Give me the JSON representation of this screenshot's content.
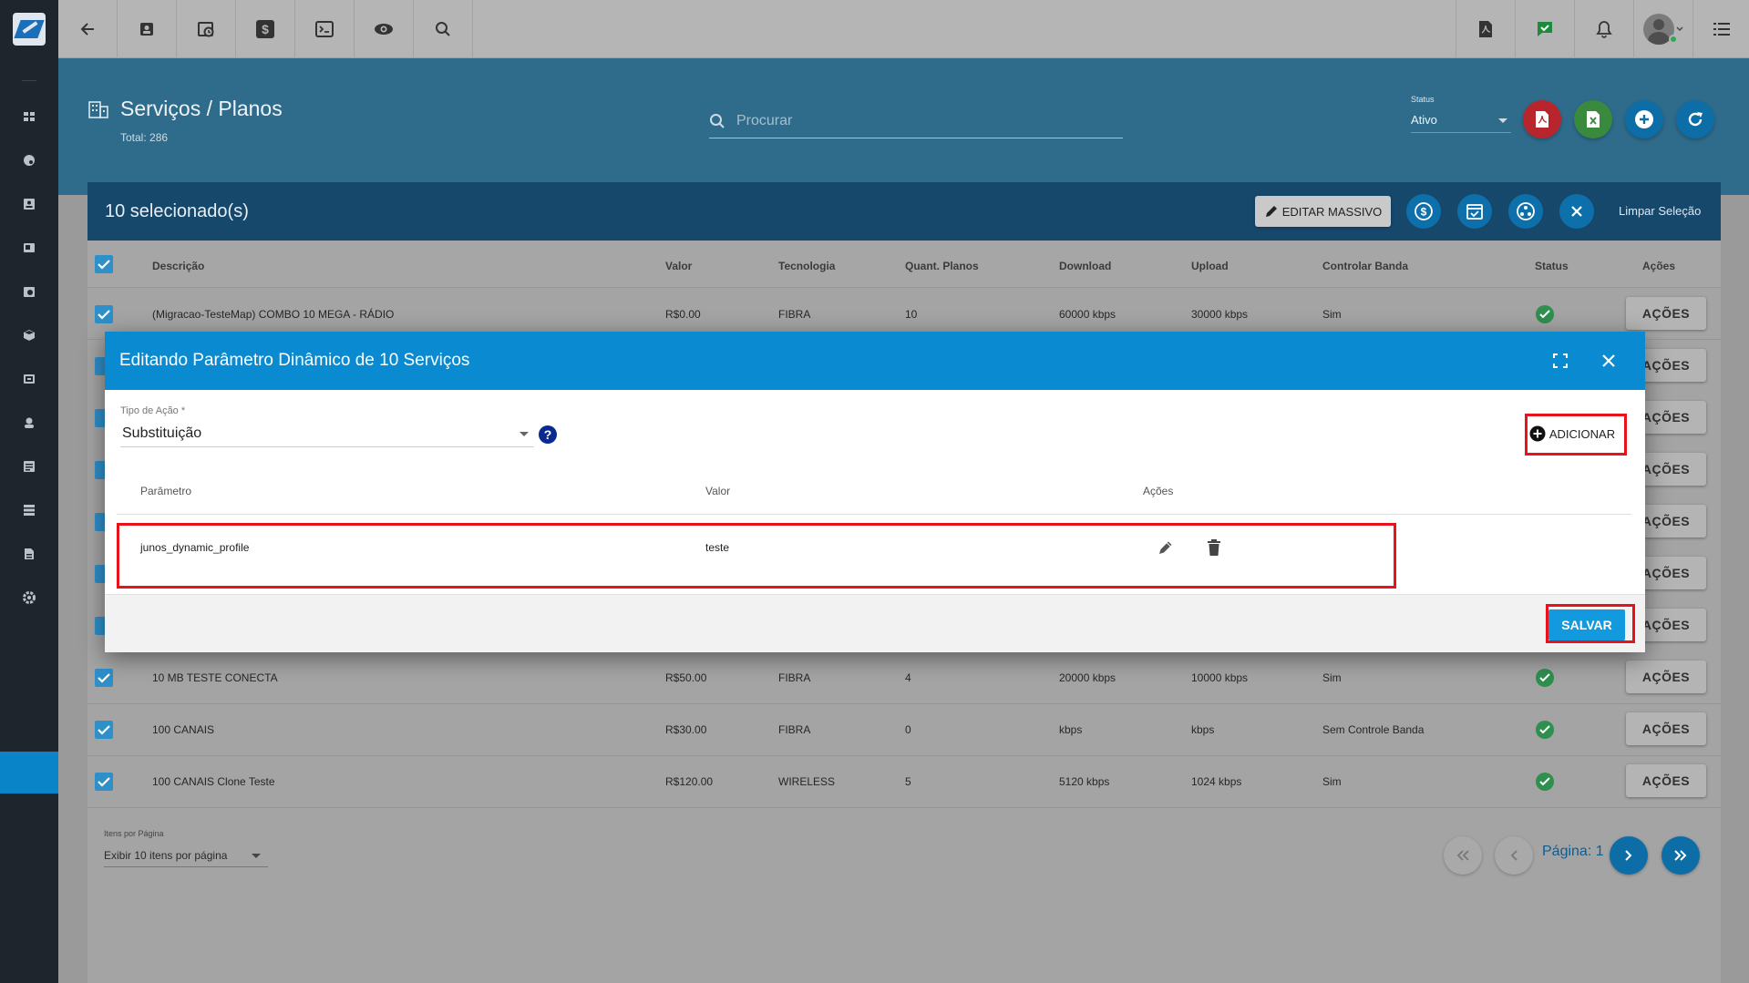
{
  "colors": {
    "sidebar": "#1f252d",
    "banner": "#2f6c8c",
    "selection_bar": "#16486c",
    "modal_header": "#0a8ad0",
    "highlight": "#e8121d",
    "save": "#1399dd"
  },
  "topbar": {
    "left_icons": [
      "back-arrow-icon",
      "contact-card-icon",
      "calendar-clock-icon",
      "dollar-icon",
      "terminal-icon",
      "eye-icon",
      "search-icon"
    ],
    "right_icons": [
      "pdf-document-icon",
      "chat-check-icon",
      "bell-icon",
      "avatar",
      "menu-list-icon"
    ]
  },
  "sidebar": {
    "icons": [
      "dashboard-icon",
      "palette-icon",
      "contacts-icon",
      "document-icon",
      "calendar-icon",
      "box-icon",
      "billing-icon",
      "headset-icon",
      "list-icon",
      "server-icon",
      "report-icon",
      "settings-icon"
    ]
  },
  "header": {
    "title": "Serviços / Planos",
    "total": "Total: 286",
    "search_placeholder": "Procurar",
    "status_label": "Status",
    "status_value": "Ativo"
  },
  "selection": {
    "count": "10 selecionado(s)",
    "mass_edit": "EDITAR MASSIVO",
    "clear": "Limpar Seleção"
  },
  "table": {
    "headers": [
      "Descrição",
      "Valor",
      "Tecnologia",
      "Quant. Planos",
      "Download",
      "Upload",
      "Controlar Banda",
      "Status",
      "Ações"
    ],
    "action_label": "AÇÕES",
    "rows": [
      {
        "descricao": "(Migracao-TesteMap) COMBO 10 MEGA - RÁDIO",
        "valor": "R$0.00",
        "tecnologia": "FIBRA",
        "quant": "10",
        "download": "60000 kbps",
        "upload": "30000 kbps",
        "banda": "Sim"
      },
      {
        "descricao": "10 MB TESTE CONECTA",
        "valor": "R$50.00",
        "tecnologia": "FIBRA",
        "quant": "4",
        "download": "20000 kbps",
        "upload": "10000 kbps",
        "banda": "Sim"
      },
      {
        "descricao": "100 CANAIS",
        "valor": "R$30.00",
        "tecnologia": "FIBRA",
        "quant": "0",
        "download": "kbps",
        "upload": "kbps",
        "banda": "Sem Controle Banda"
      },
      {
        "descricao": "100 CANAIS Clone Teste",
        "valor": "R$120.00",
        "tecnologia": "WIRELESS",
        "quant": "5",
        "download": "5120 kbps",
        "upload": "1024 kbps",
        "banda": "Sim"
      }
    ]
  },
  "pagination": {
    "items_label": "Itens por Página",
    "items_value": "Exibir 10 itens por página",
    "page_label": "Página: 1"
  },
  "modal": {
    "title": "Editando Parâmetro Dinâmico de 10 Serviços",
    "action_type_label": "Tipo de Ação *",
    "action_type_value": "Substituição",
    "help": "?",
    "add_label": "ADICIONAR",
    "headers": [
      "Parâmetro",
      "Valor",
      "Ações"
    ],
    "row": {
      "parametro": "junos_dynamic_profile",
      "valor": "teste"
    },
    "save_label": "SALVAR"
  }
}
